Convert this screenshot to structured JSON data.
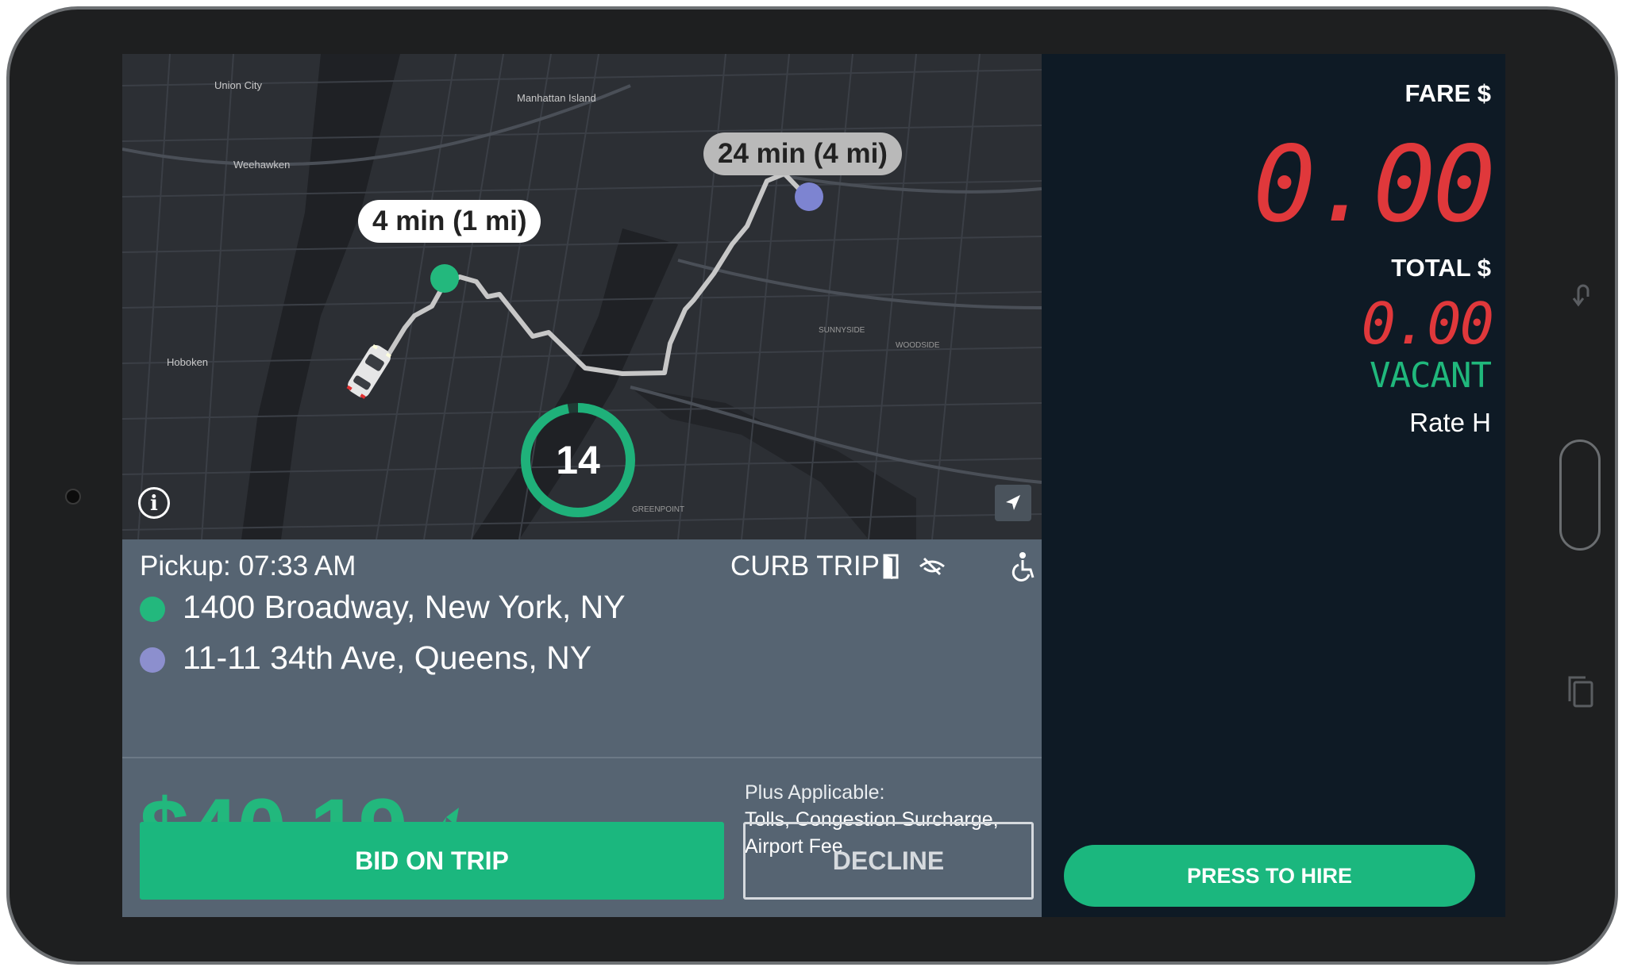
{
  "map": {
    "labels": [
      "Union City",
      "Manhattan Island",
      "Weehawken",
      "Hoboken",
      "SUNNYSIDE",
      "WOODSIDE",
      "GREENPOINT"
    ],
    "eta_pickup": "4 min (1 mi)",
    "eta_dropoff": "24 min (4 mi)",
    "countdown": "14",
    "countdown_fraction": 0.97,
    "colors": {
      "pickup": "#23b87d",
      "dropoff": "#7d84d1",
      "route": "#c9c9c9"
    }
  },
  "trip": {
    "pickup_time": "Pickup: 07:33 AM",
    "trip_type": "CURB TRIP",
    "icons": [
      "door-icon",
      "no-see-icon",
      "wheelchair-icon"
    ],
    "pickup_address": "1400 Broadway, New York, NY",
    "dropoff_address": "11-11 34th Ave, Queens, NY",
    "price": "$40.19",
    "plus_title": "Plus Applicable:",
    "plus_line1": "Tolls, Congestion Surcharge,",
    "plus_line2": "Airport Fee",
    "bid_label": "BID ON TRIP",
    "decline_label": "DECLINE"
  },
  "meter": {
    "fare_label": "FARE $",
    "fare_value": "0.00",
    "total_label": "TOTAL $",
    "total_value": "0.00",
    "status": "VACANT",
    "rate": "Rate H",
    "hire_label": "PRESS TO HIRE"
  }
}
